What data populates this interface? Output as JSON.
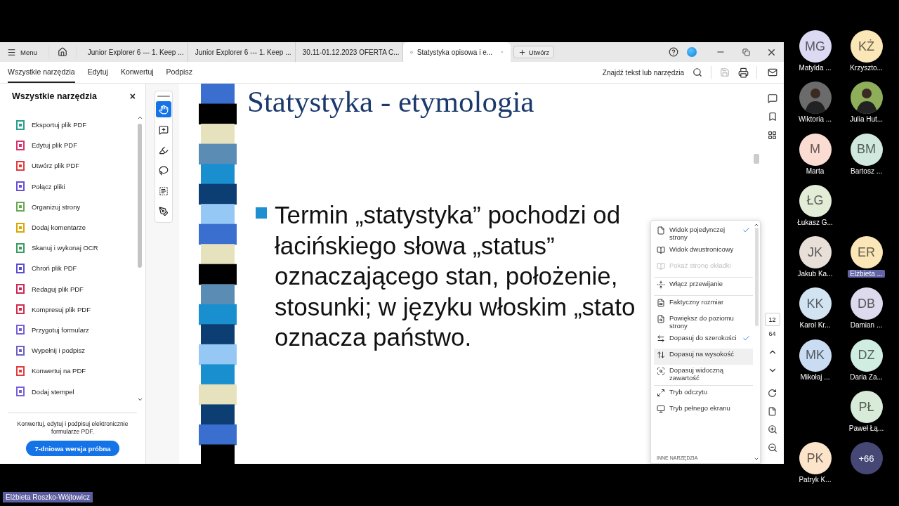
{
  "tab_bar": {
    "menu": "Menu",
    "tabs": [
      {
        "label": "Junior Explorer 6 --- 1. Keep ...",
        "selected": false
      },
      {
        "label": "Junior Explorer 6 --- 1. Keep ...",
        "selected": false
      },
      {
        "label": "30.11-01.12.2023 OFERTA C...",
        "selected": false
      },
      {
        "label": "Statystyka opisowa i e...",
        "selected": true
      }
    ],
    "new_tab": "Utwórz"
  },
  "toolbar": {
    "tabs": [
      {
        "label": "Wszystkie narzędzia",
        "selected": true
      },
      {
        "label": "Edytuj",
        "selected": false
      },
      {
        "label": "Konwertuj",
        "selected": false
      },
      {
        "label": "Podpisz",
        "selected": false
      }
    ],
    "search": "Znajdź tekst lub narzędzia",
    "save_disabled": true
  },
  "tools_panel": {
    "title": "Wszystkie narzędzia",
    "close": "×",
    "items": [
      {
        "label": "Eksportuj plik PDF",
        "color": "#2a9d8f"
      },
      {
        "label": "Edytuj plik PDF",
        "color": "#d6336c"
      },
      {
        "label": "Utwórz plik PDF",
        "color": "#e03e3e"
      },
      {
        "label": "Połącz pliki",
        "color": "#6a4fd6"
      },
      {
        "label": "Organizuj strony",
        "color": "#6aa84f"
      },
      {
        "label": "Dodaj komentarze",
        "color": "#d9a800"
      },
      {
        "label": "Skanuj i wykonaj OCR",
        "color": "#3a9d5d"
      },
      {
        "label": "Chroń plik PDF",
        "color": "#5a4fcf"
      },
      {
        "label": "Redaguj plik PDF",
        "color": "#c92a5a"
      },
      {
        "label": "Kompresuj plik PDF",
        "color": "#d62a4a"
      },
      {
        "label": "Przygotuj formularz",
        "color": "#7a5fd6"
      },
      {
        "label": "Wypełnij i podpisz",
        "color": "#6c5fc7"
      },
      {
        "label": "Konwertuj na PDF",
        "color": "#e03e3e"
      },
      {
        "label": "Dodaj stempel",
        "color": "#7a5fd6"
      }
    ],
    "promo": "Konwertuj, edytuj i podpisuj elektronicznie formularze PDF.",
    "button": "7-dniowa wersja próbna"
  },
  "quick_tools": [
    {
      "selected": true
    },
    {
      "selected": false
    },
    {
      "selected": false
    },
    {
      "selected": false
    },
    {
      "selected": false
    },
    {
      "selected": false
    }
  ],
  "slide": {
    "title": "Statystyka - etymologia",
    "bullet_lines": [
      "Termin „statystyka” pochodzi od",
      "łacińskiego słowa „status”",
      "oznaczającego stan, położenie,",
      "stosunki; w języku włoskim „stato",
      "oznacza państwo."
    ]
  },
  "view_menu": {
    "groups": [
      [
        {
          "label": "Widok pojedynczej strony",
          "checked": true,
          "disabled": false,
          "highlighted": false
        },
        {
          "label": "Widok dwustronicowy",
          "checked": false,
          "disabled": false,
          "highlighted": false
        },
        {
          "label": "Pokaż stronę okładki",
          "checked": false,
          "disabled": true,
          "highlighted": false
        }
      ],
      [
        {
          "label": "Włącz przewijanie",
          "checked": false,
          "disabled": false,
          "highlighted": false
        }
      ],
      [
        {
          "label": "Faktyczny rozmiar",
          "checked": false,
          "disabled": false,
          "highlighted": false
        },
        {
          "label": "Powiększ do poziomu strony",
          "checked": false,
          "disabled": false,
          "highlighted": false
        },
        {
          "label": "Dopasuj do szerokości",
          "checked": true,
          "disabled": false,
          "highlighted": false
        },
        {
          "label": "Dopasuj na wysokość",
          "checked": false,
          "disabled": false,
          "highlighted": true
        },
        {
          "label": "Dopasuj widoczną zawartość",
          "checked": false,
          "disabled": false,
          "highlighted": false
        }
      ],
      [
        {
          "label": "Tryb odczytu",
          "checked": false,
          "disabled": false,
          "highlighted": false
        },
        {
          "label": "Tryb pełnego ekranu",
          "checked": false,
          "disabled": false,
          "highlighted": false
        }
      ]
    ],
    "section": "INNE NARZĘDZIA"
  },
  "page_nav": {
    "page": "12",
    "total": "64"
  },
  "participants": {
    "rows": [
      {
        "left": {
          "kind": "initials",
          "initials": "MG",
          "name": "Matylda ...",
          "color": "#dcd9f2",
          "highlighted": false
        },
        "right": {
          "kind": "initials",
          "initials": "KŻ",
          "name": "Krzyszto...",
          "color": "#fbe6b8",
          "highlighted": false
        }
      },
      {
        "left": {
          "kind": "photo",
          "name": "Wiktoria ...",
          "color": "#6b6b6b",
          "highlighted": false
        },
        "right": {
          "kind": "photo",
          "name": "Julia Hut...",
          "color": "#8fae5a",
          "highlighted": false
        }
      },
      {
        "left": {
          "kind": "initials",
          "initials": "M",
          "name": "Marta",
          "color": "#fbdcd2",
          "highlighted": false
        },
        "right": {
          "kind": "initials",
          "initials": "BM",
          "name": "Bartosz ...",
          "color": "#d0e8dd",
          "highlighted": false
        }
      },
      {
        "left": {
          "kind": "initials",
          "initials": "ŁG",
          "name": "Łukasz G...",
          "color": "#e2ecd7",
          "highlighted": false
        }
      },
      {
        "left": {
          "kind": "initials",
          "initials": "JK",
          "name": "Jakub Ka...",
          "color": "#e8dfd9",
          "highlighted": false
        },
        "right": {
          "kind": "initials",
          "initials": "ER",
          "name": "Elżbieta ...",
          "color": "#fbe6b8",
          "highlighted": true
        }
      },
      {
        "left": {
          "kind": "initials",
          "initials": "KK",
          "name": "Karol Kr...",
          "color": "#d2e3f2",
          "highlighted": false
        },
        "right": {
          "kind": "initials",
          "initials": "DB",
          "name": "Damian ...",
          "color": "#dedaee",
          "highlighted": false
        }
      },
      {
        "left": {
          "kind": "initials",
          "initials": "MK",
          "name": "Mikołaj ...",
          "color": "#cadcf2",
          "highlighted": false
        },
        "right": {
          "kind": "initials",
          "initials": "DZ",
          "name": "Daria Za...",
          "color": "#d0ede1",
          "highlighted": false
        }
      },
      {
        "right": {
          "kind": "initials",
          "initials": "PŁ",
          "name": "Paweł Łą...",
          "color": "#d8ead8",
          "highlighted": false
        }
      },
      {
        "left": {
          "kind": "initials",
          "initials": "PK",
          "name": "Patryk K...",
          "color": "#fce4ca",
          "highlighted": false
        },
        "right": {
          "kind": "more",
          "initials": "+66",
          "color": "#464775"
        }
      }
    ]
  },
  "presenter": "Elżbieta Roszko-Wójtowicz"
}
